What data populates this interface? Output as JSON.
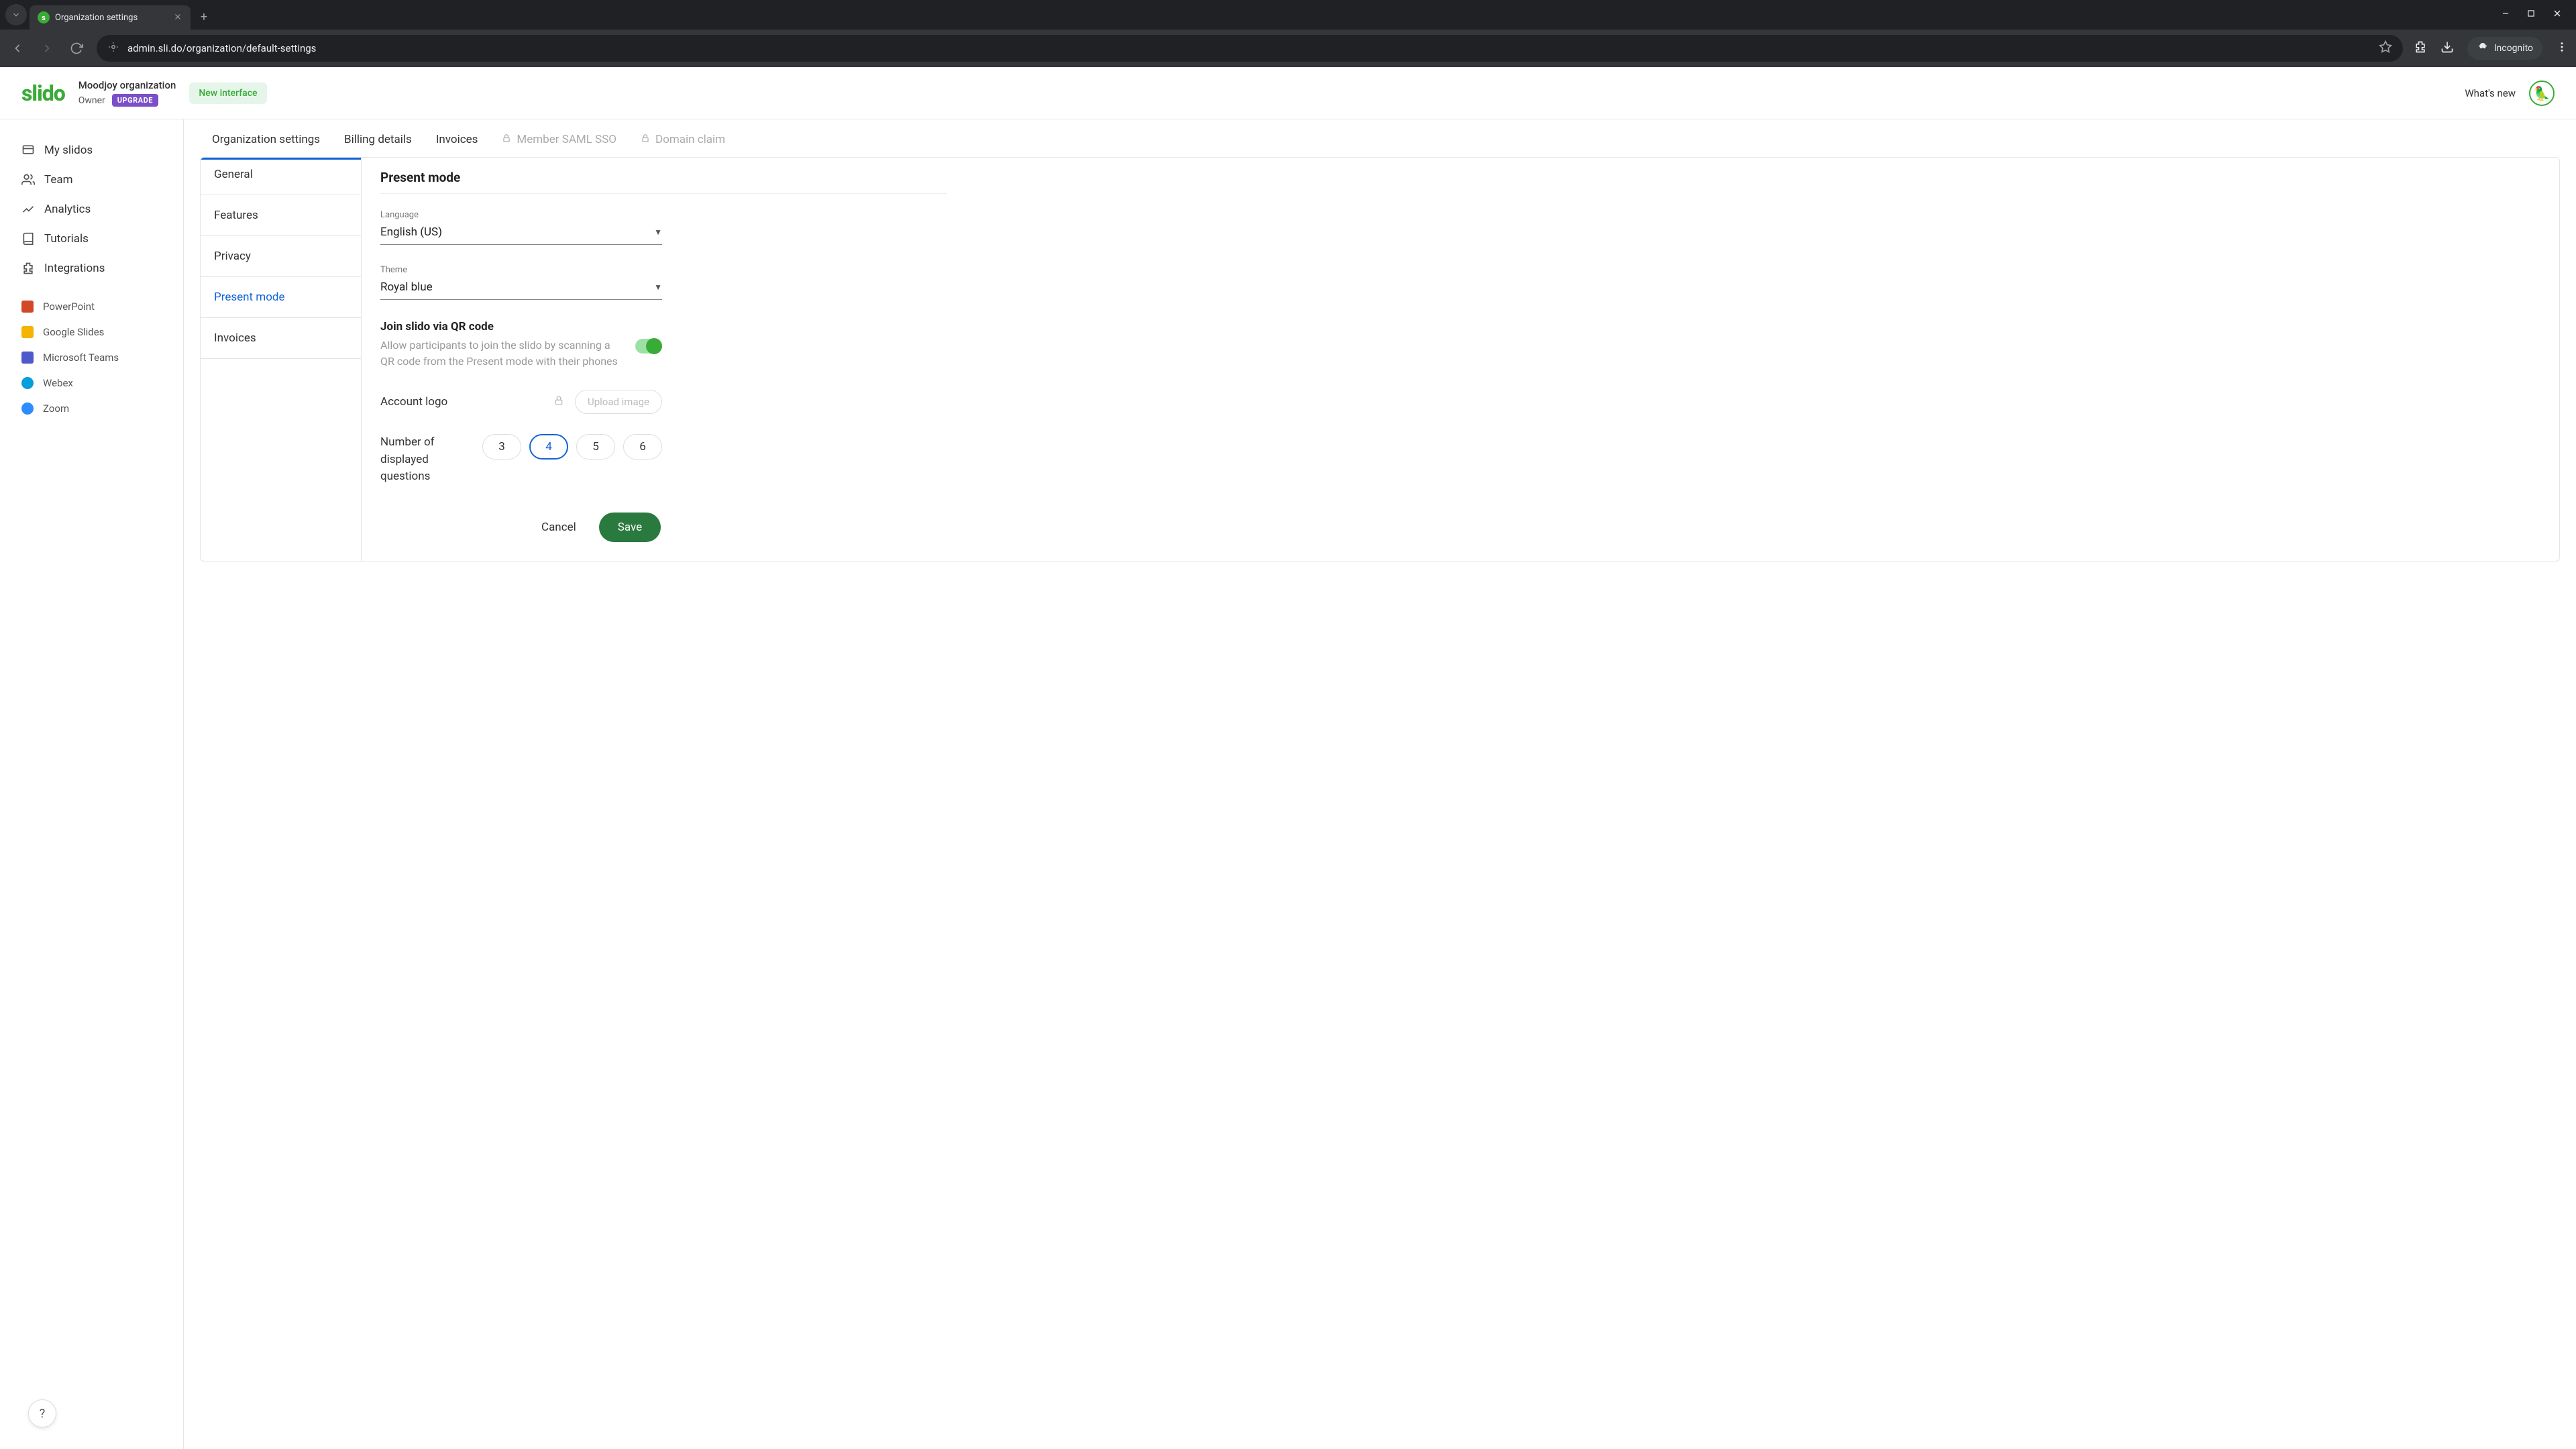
{
  "browser": {
    "tab_title": "Organization settings",
    "url": "admin.sli.do/organization/default-settings",
    "incognito": "Incognito"
  },
  "header": {
    "logo": "slido",
    "org_name": "Moodjoy organization",
    "role": "Owner",
    "upgrade": "UPGRADE",
    "new_interface": "New interface",
    "whats_new": "What's new"
  },
  "sidebar": {
    "items": [
      {
        "label": "My slidos"
      },
      {
        "label": "Team"
      },
      {
        "label": "Analytics"
      },
      {
        "label": "Tutorials"
      },
      {
        "label": "Integrations"
      }
    ],
    "integrations": [
      {
        "label": "PowerPoint"
      },
      {
        "label": "Google Slides"
      },
      {
        "label": "Microsoft Teams"
      },
      {
        "label": "Webex"
      },
      {
        "label": "Zoom"
      }
    ]
  },
  "top_tabs": {
    "org_settings": "Organization settings",
    "billing": "Billing details",
    "invoices": "Invoices",
    "saml": "Member SAML SSO",
    "domain": "Domain claim"
  },
  "settings_nav": {
    "general": "General",
    "features": "Features",
    "privacy": "Privacy",
    "present_mode": "Present mode",
    "invoices": "Invoices"
  },
  "content": {
    "section_title": "Present mode",
    "language_label": "Language",
    "language_value": "English (US)",
    "theme_label": "Theme",
    "theme_value": "Royal blue",
    "qr_title": "Join slido via QR code",
    "qr_desc": "Allow participants to join the slido by scanning a QR code from the Present mode with their phones",
    "logo_label": "Account logo",
    "upload_label": "Upload image",
    "questions_label": "Number of displayed questions",
    "q_opts": [
      "3",
      "4",
      "5",
      "6"
    ],
    "q_selected": "4",
    "cancel": "Cancel",
    "save": "Save"
  },
  "help": "?"
}
